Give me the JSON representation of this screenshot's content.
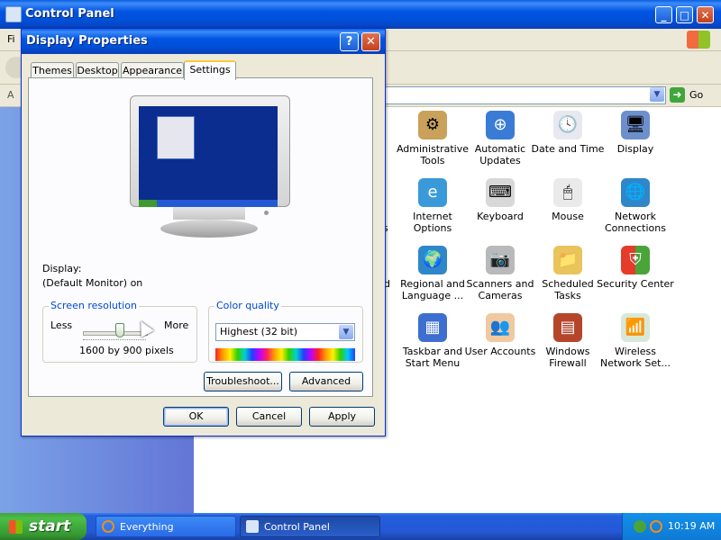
{
  "control_panel": {
    "title": "Control Panel",
    "menu_first": "Fi",
    "address_first": "A",
    "go_label": "Go",
    "items": [
      {
        "name": "admin-tools-icon",
        "label": "Administrative Tools"
      },
      {
        "name": "automatic-updates-icon",
        "label": "Automatic Updates"
      },
      {
        "name": "date-time-icon",
        "label": "Date and Time"
      },
      {
        "name": "display-icon",
        "label": "Display"
      },
      {
        "name": "internet-options-icon",
        "label": "Internet Options"
      },
      {
        "name": "keyboard-icon",
        "label": "Keyboard"
      },
      {
        "name": "mouse-icon",
        "label": "Mouse"
      },
      {
        "name": "network-connections-icon",
        "label": "Network Connections"
      },
      {
        "name": "regional-language-icon",
        "label": "Regional and Language ..."
      },
      {
        "name": "scanners-cameras-icon",
        "label": "Scanners and Cameras"
      },
      {
        "name": "scheduled-tasks-icon",
        "label": "Scheduled Tasks"
      },
      {
        "name": "security-center-icon",
        "label": "Security Center"
      },
      {
        "name": "taskbar-startmenu-icon",
        "label": "Taskbar and Start Menu"
      },
      {
        "name": "user-accounts-icon",
        "label": "User Accounts"
      },
      {
        "name": "windows-firewall-icon",
        "label": "Windows Firewall"
      },
      {
        "name": "wireless-network-icon",
        "label": "Wireless Network Set..."
      }
    ],
    "clipped_fragments": {
      "s": "s",
      "nd": "nd"
    }
  },
  "dialog": {
    "title": "Display Properties",
    "help": "?",
    "close": "✕",
    "tabs": [
      "Themes",
      "Desktop",
      "Appearance",
      "Settings"
    ],
    "active_tab": "Settings",
    "display_label": "Display:",
    "display_value": "(Default Monitor) on",
    "screen_resolution": {
      "title": "Screen resolution",
      "less": "Less",
      "more": "More",
      "value": "1600 by 900 pixels"
    },
    "color_quality": {
      "title": "Color quality",
      "selected": "Highest (32 bit)"
    },
    "buttons": {
      "troubleshoot": "Troubleshoot...",
      "advanced": "Advanced",
      "ok": "OK",
      "cancel": "Cancel",
      "apply": "Apply"
    }
  },
  "taskbar": {
    "start": "start",
    "tasks": [
      "Everything",
      "Control Panel"
    ],
    "clock": "10:19 AM"
  }
}
